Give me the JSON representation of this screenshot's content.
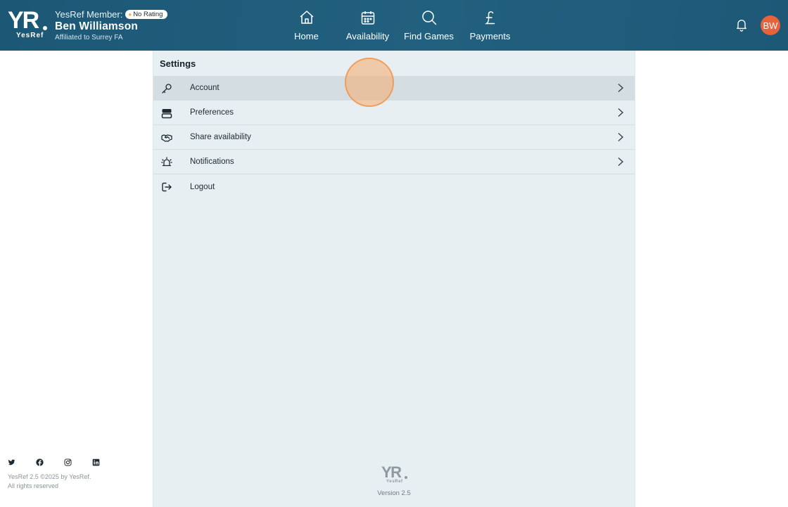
{
  "header": {
    "logo_text": "YR",
    "logo_word": "YesRef",
    "member_label": "YesRef Member:",
    "rating_badge": "No Rating",
    "user_name": "Ben Williamson",
    "affiliation": "Affiliated to Surrey FA",
    "avatar_initials": "BW",
    "avatar_color": "#e8623a",
    "nav": [
      {
        "label": "Home",
        "icon": "home-icon"
      },
      {
        "label": "Availability",
        "icon": "calendar-icon"
      },
      {
        "label": "Find Games",
        "icon": "search-icon"
      },
      {
        "label": "Payments",
        "icon": "pound-icon"
      }
    ],
    "notification_icon": "bell-icon"
  },
  "settings": {
    "title": "Settings",
    "items": [
      {
        "label": "Account",
        "icon": "key-icon",
        "has_chevron": true,
        "active": true
      },
      {
        "label": "Preferences",
        "icon": "toggle-icon",
        "has_chevron": true
      },
      {
        "label": "Share availability",
        "icon": "handshake-icon",
        "has_chevron": true
      },
      {
        "label": "Notifications",
        "icon": "alarm-icon",
        "has_chevron": true
      },
      {
        "label": "Logout",
        "icon": "logout-icon",
        "has_chevron": false
      }
    ],
    "version": "Version 2.5"
  },
  "footer": {
    "socials": [
      "twitter-icon",
      "facebook-icon",
      "instagram-icon",
      "linkedin-icon"
    ],
    "copyright_line1": "YesRef 2.5 ©2025 by YesRef.",
    "copyright_line2": "All rights reserved"
  },
  "colors": {
    "header_bg": "#1f5b7a",
    "panel_bg": "#e8eff2",
    "active_row": "#d3dde2"
  }
}
